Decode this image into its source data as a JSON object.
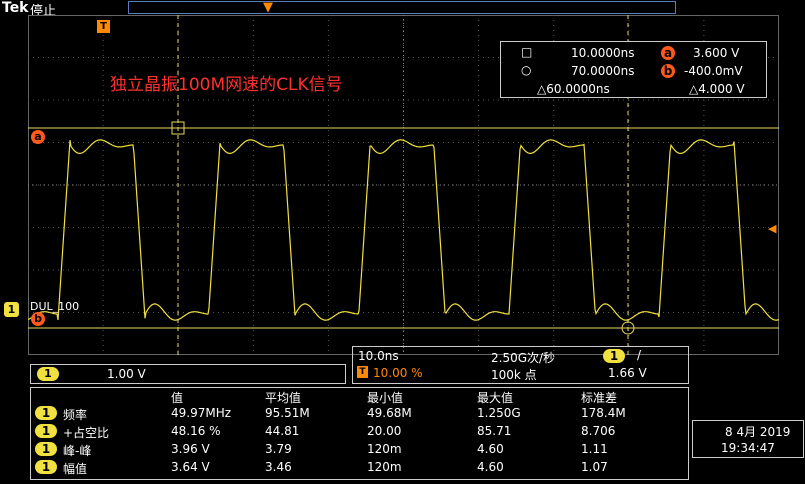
{
  "header": {
    "brand": "Tek",
    "state": "停止"
  },
  "annotation": "独立晶振100M网速的CLK信号",
  "markers": {
    "cursor_a": "a",
    "cursor_b": "b",
    "ch1": "1",
    "trigger": "T",
    "ch1_label": "DUL_100"
  },
  "cursors": {
    "a_time": "10.0000ns",
    "b_time": "70.0000ns",
    "delta_time": "△60.0000ns",
    "a_volt": "3.600 V",
    "b_volt": "-400.0mV",
    "delta_volt": "△4.000 V"
  },
  "channel": {
    "badge": "1",
    "scale": "1.00 V"
  },
  "horizontal": {
    "timebase": "10.0ns",
    "sample_rate": "2.50G次/秒",
    "trigger_pos": "10.00 %",
    "record": "100k 点",
    "trig_ch": "1",
    "trig_slope": "/",
    "trig_level": "1.66 V"
  },
  "measurements": {
    "headers": [
      "值",
      "平均值",
      "最小值",
      "最大值",
      "标准差"
    ],
    "rows": [
      {
        "ch": "1",
        "name": "频率",
        "values": [
          "49.97MHz",
          "95.51M",
          "49.68M",
          "1.250G",
          "178.4M"
        ]
      },
      {
        "ch": "1",
        "name": "+占空比",
        "values": [
          "48.16 %",
          "44.81",
          "20.00",
          "85.71",
          "8.706"
        ]
      },
      {
        "ch": "1",
        "name": "峰-峰",
        "values": [
          "3.96 V",
          "3.79",
          "120m",
          "4.60",
          "1.11"
        ]
      },
      {
        "ch": "1",
        "name": "幅值",
        "values": [
          "3.64 V",
          "3.46",
          "120m",
          "4.60",
          "1.07"
        ]
      }
    ]
  },
  "datetime": {
    "date": "8 4月 2019",
    "time": "19:34:47"
  },
  "colors": {
    "trace": "#f0e040",
    "cursor": "#e8d860",
    "accent": "#ff8a00",
    "annotation": "#ff3030"
  }
}
